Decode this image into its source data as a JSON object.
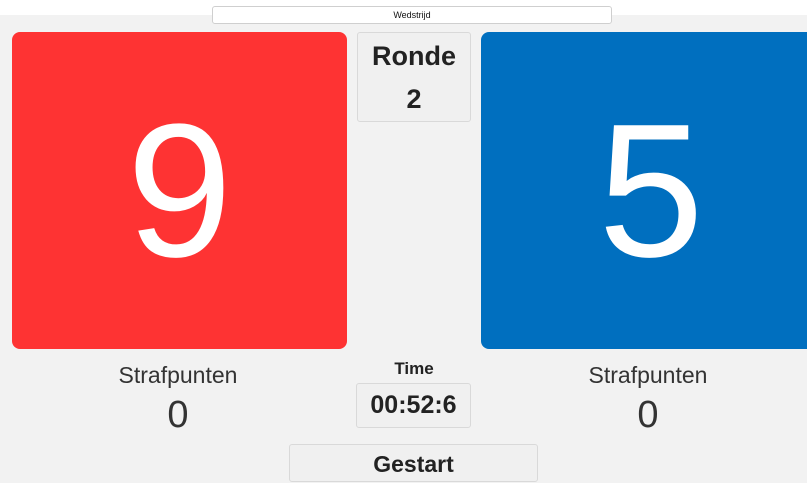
{
  "match": {
    "label": "Wedstrijd"
  },
  "competitors": [
    {
      "side": "red",
      "score": "9",
      "penalty_label": "Strafpunten",
      "penalty": "0",
      "color": "#fe3333"
    },
    {
      "side": "blue",
      "score": "5",
      "penalty_label": "Strafpunten",
      "penalty": "0",
      "color": "#006fbf"
    }
  ],
  "round": {
    "label": "Ronde",
    "value": "2"
  },
  "timer": {
    "label": "Time",
    "value": "00:52:6"
  },
  "status": {
    "label": "Gestart"
  }
}
